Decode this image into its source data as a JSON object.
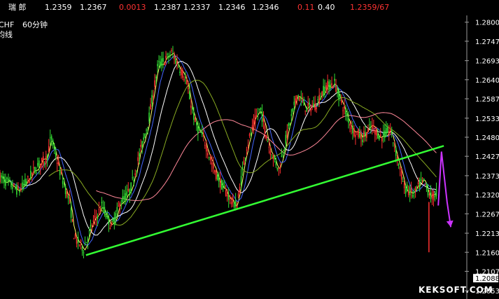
{
  "quote_bar": {
    "name": "瑞 郎",
    "open": "1.2359",
    "high": "1.2367",
    "change": "0.0013",
    "v1": "1.2387",
    "v2": "1.2337",
    "v3": "1.2346",
    "v4": "1.2346",
    "v5": "0.11",
    "v6": "0.40",
    "v7": "1.2359/67"
  },
  "chart_label": {
    "symbol": "CHF",
    "period": "60分钟",
    "indicator": "均线"
  },
  "price_tag": "1.2088",
  "watermark": "KEKSOFT.COM",
  "colors": {
    "background": "#000000",
    "grid": "#8a8a8a",
    "candle_up": "#ff3030",
    "candle_down": "#33dd33",
    "candle_flat": "#ffff44",
    "trendline": "#33ff33",
    "arrow": "#cc33ff",
    "ma_fast": "#ffff66",
    "ma_blue": "#4466ff",
    "ma_white": "#ffffff",
    "ma_olive": "#88aa22",
    "ma_pink": "#ff8899",
    "red_text": "#ff3333",
    "white_text": "#ffffff"
  },
  "chart_data": {
    "type": "line",
    "y_ticks": [
      "1.2800",
      "1.2747",
      "1.2693",
      "1.2640",
      "1.2587",
      "1.2533",
      "1.2480",
      "1.2427",
      "1.2373",
      "1.2320",
      "1.2267",
      "1.2213",
      "1.2160",
      "1.2107",
      "1.2053"
    ],
    "ylim": [
      1.203,
      1.2815
    ],
    "x_range": [
      0,
      100
    ],
    "price_path": [
      [
        0,
        1.237
      ],
      [
        2,
        1.235
      ],
      [
        4,
        1.233
      ],
      [
        6,
        1.236
      ],
      [
        8,
        1.24
      ],
      [
        10,
        1.242
      ],
      [
        11,
        1.248
      ],
      [
        13,
        1.238
      ],
      [
        15,
        1.23
      ],
      [
        16,
        1.22
      ],
      [
        18,
        1.217
      ],
      [
        20,
        1.224
      ],
      [
        22,
        1.229
      ],
      [
        24,
        1.223
      ],
      [
        26,
        1.23
      ],
      [
        28,
        1.233
      ],
      [
        30,
        1.243
      ],
      [
        32,
        1.253
      ],
      [
        34,
        1.268
      ],
      [
        36,
        1.27
      ],
      [
        37,
        1.2715
      ],
      [
        38,
        1.269
      ],
      [
        40,
        1.264
      ],
      [
        42,
        1.252
      ],
      [
        44,
        1.247
      ],
      [
        46,
        1.239
      ],
      [
        48,
        1.234
      ],
      [
        50,
        1.23
      ],
      [
        51,
        1.229
      ],
      [
        53,
        1.245
      ],
      [
        55,
        1.253
      ],
      [
        56,
        1.256
      ],
      [
        58,
        1.245
      ],
      [
        60,
        1.239
      ],
      [
        62,
        1.25
      ],
      [
        64,
        1.26
      ],
      [
        66,
        1.256
      ],
      [
        68,
        1.257
      ],
      [
        70,
        1.262
      ],
      [
        72,
        1.263
      ],
      [
        74,
        1.256
      ],
      [
        76,
        1.25
      ],
      [
        78,
        1.248
      ],
      [
        80,
        1.251
      ],
      [
        82,
        1.248
      ],
      [
        84,
        1.25
      ],
      [
        85,
        1.245
      ],
      [
        87,
        1.234
      ],
      [
        89,
        1.232
      ],
      [
        91,
        1.236
      ],
      [
        93,
        1.231
      ],
      [
        94,
        1.233
      ]
    ],
    "trendline": [
      [
        18.5,
        1.2152
      ],
      [
        95.5,
        1.2456
      ]
    ],
    "arrow": [
      [
        94.3,
        1.229
      ],
      [
        95.0,
        1.244
      ],
      [
        96.2,
        1.23
      ],
      [
        97.0,
        1.223
      ]
    ],
    "price_tag_value": 1.2088
  }
}
